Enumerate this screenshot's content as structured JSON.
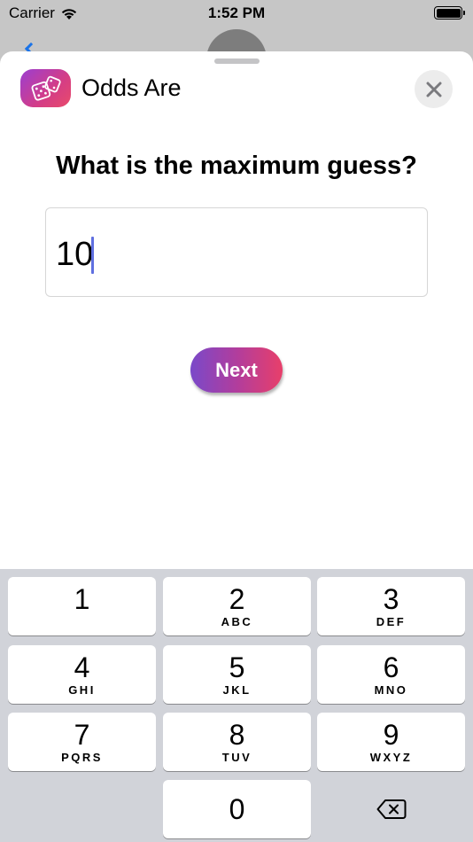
{
  "status_bar": {
    "carrier": "Carrier",
    "time": "1:52 PM"
  },
  "header": {
    "app_name": "Odds Are",
    "app_icon": "dice-icon",
    "close_icon": "close-icon"
  },
  "prompt": {
    "question": "What is the maximum guess?"
  },
  "input": {
    "value": "10"
  },
  "actions": {
    "next_label": "Next"
  },
  "keypad": {
    "keys": [
      {
        "num": "1",
        "letters": ""
      },
      {
        "num": "2",
        "letters": "ABC"
      },
      {
        "num": "3",
        "letters": "DEF"
      },
      {
        "num": "4",
        "letters": "GHI"
      },
      {
        "num": "5",
        "letters": "JKL"
      },
      {
        "num": "6",
        "letters": "MNO"
      },
      {
        "num": "7",
        "letters": "PQRS"
      },
      {
        "num": "8",
        "letters": "TUV"
      },
      {
        "num": "9",
        "letters": "WXYZ"
      },
      {
        "num": "0",
        "letters": ""
      }
    ],
    "delete_icon": "backspace-icon"
  },
  "colors": {
    "brand_gradient_start": "#7a49c9",
    "brand_gradient_end": "#e83f6a",
    "caret": "#5f6fe0"
  }
}
